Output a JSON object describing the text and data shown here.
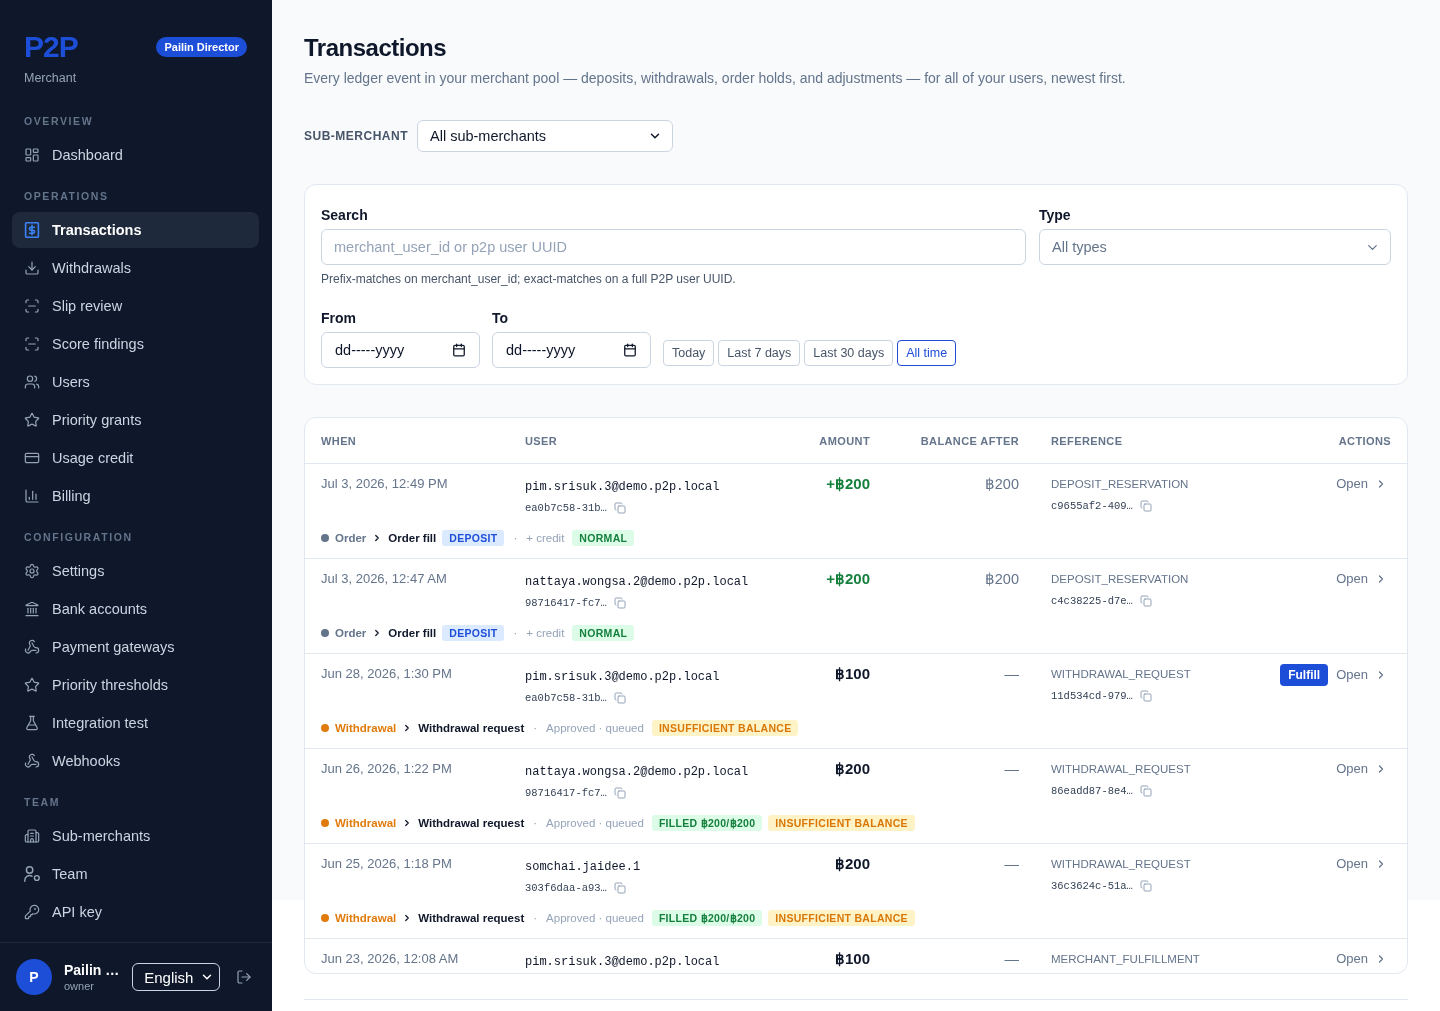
{
  "sidebar": {
    "logo": "P2P",
    "logo_subtitle": "Merchant",
    "role_badge": "Pailin Director",
    "sections": [
      {
        "label": "OVERVIEW",
        "items": [
          {
            "label": "Dashboard",
            "selected": false
          }
        ]
      },
      {
        "label": "OPERATIONS",
        "items": [
          {
            "label": "Transactions",
            "selected": true
          },
          {
            "label": "Withdrawals",
            "selected": false
          },
          {
            "label": "Slip review",
            "selected": false
          },
          {
            "label": "Score findings",
            "selected": false
          },
          {
            "label": "Users",
            "selected": false
          },
          {
            "label": "Priority grants",
            "selected": false
          },
          {
            "label": "Usage credit",
            "selected": false
          },
          {
            "label": "Billing",
            "selected": false
          }
        ]
      },
      {
        "label": "CONFIGURATION",
        "items": [
          {
            "label": "Settings",
            "selected": false
          },
          {
            "label": "Bank accounts",
            "selected": false
          },
          {
            "label": "Payment gateways",
            "selected": false
          },
          {
            "label": "Priority thresholds",
            "selected": false
          },
          {
            "label": "Integration test",
            "selected": false
          },
          {
            "label": "Webhooks",
            "selected": false
          }
        ]
      },
      {
        "label": "TEAM",
        "items": [
          {
            "label": "Sub-merchants",
            "selected": false
          },
          {
            "label": "Team",
            "selected": false
          },
          {
            "label": "API key",
            "selected": false
          }
        ]
      }
    ],
    "user": {
      "avatar_initial": "P",
      "name": "Pailin …",
      "role": "owner",
      "language": "English"
    }
  },
  "page": {
    "title": "Transactions",
    "subtitle": "Every ledger event in your merchant pool — deposits, withdrawals, order holds, and adjustments — for all of your users, newest first."
  },
  "sub_merchant_filter": {
    "label": "SUB-MERCHANT",
    "value": "All sub-merchants"
  },
  "filters": {
    "search": {
      "label": "Search",
      "placeholder": "merchant_user_id or p2p user UUID",
      "hint": "Prefix-matches on merchant_user_id; exact-matches on a full P2P user UUID."
    },
    "type": {
      "label": "Type",
      "value": "All types"
    },
    "from": {
      "label": "From",
      "placeholder": "dd-----yyyy"
    },
    "to": {
      "label": "To",
      "placeholder": "dd-----yyyy"
    },
    "quick_ranges": [
      {
        "label": "Today",
        "selected": false
      },
      {
        "label": "Last 7 days",
        "selected": false
      },
      {
        "label": "Last 30 days",
        "selected": false
      },
      {
        "label": "All time",
        "selected": true
      }
    ]
  },
  "table": {
    "columns": [
      "WHEN",
      "USER",
      "AMOUNT",
      "BALANCE AFTER",
      "REFERENCE",
      "ACTIONS"
    ],
    "rows": [
      {
        "kind": "credit",
        "when": "Jul 3, 2026, 12:49 PM",
        "user": "pim.srisuk.3@demo.p2p.local",
        "user_id": "ea0b7c58-31b…",
        "amount": "+฿200",
        "balance_after": "฿200",
        "reference": "DEPOSIT_RESERVATION",
        "reference_id": "c9655af2-409…",
        "open": "Open",
        "category": {
          "label": "Order",
          "color": "#64748b"
        },
        "subcategory": "Order fill",
        "type_badge": {
          "label": "DEPOSIT",
          "kind": "info"
        },
        "separator": "·",
        "note": "+ credit",
        "tags": [
          {
            "label": "NORMAL",
            "kind": "success"
          }
        ]
      },
      {
        "kind": "credit",
        "when": "Jul 3, 2026, 12:47 AM",
        "user": "nattaya.wongsa.2@demo.p2p.local",
        "user_id": "98716417-fc7…",
        "amount": "+฿200",
        "balance_after": "฿200",
        "reference": "DEPOSIT_RESERVATION",
        "reference_id": "c4c38225-d7e…",
        "open": "Open",
        "category": {
          "label": "Order",
          "color": "#64748b"
        },
        "subcategory": "Order fill",
        "type_badge": {
          "label": "DEPOSIT",
          "kind": "info"
        },
        "separator": "·",
        "note": "+ credit",
        "tags": [
          {
            "label": "NORMAL",
            "kind": "success"
          }
        ]
      },
      {
        "kind": "plain",
        "when": "Jun 28, 2026, 1:30 PM",
        "user": "pim.srisuk.3@demo.p2p.local",
        "user_id": "ea0b7c58-31b…",
        "amount": "฿100",
        "balance_after": "—",
        "reference": "WITHDRAWAL_REQUEST",
        "reference_id": "11d534cd-979…",
        "action_button": "Fulfill",
        "open": "Open",
        "category": {
          "label": "Withdrawal",
          "color": "#e07b0c"
        },
        "subcategory": "Withdrawal request",
        "separator": "·",
        "note": "Approved · queued",
        "tags": [
          {
            "label": "INSUFFICIENT BALANCE",
            "kind": "warning"
          }
        ]
      },
      {
        "kind": "plain",
        "when": "Jun 26, 2026, 1:22 PM",
        "user": "nattaya.wongsa.2@demo.p2p.local",
        "user_id": "98716417-fc7…",
        "amount": "฿200",
        "balance_after": "—",
        "reference": "WITHDRAWAL_REQUEST",
        "reference_id": "86eadd87-8e4…",
        "open": "Open",
        "category": {
          "label": "Withdrawal",
          "color": "#e07b0c"
        },
        "subcategory": "Withdrawal request",
        "separator": "·",
        "note": "Approved · queued",
        "tags": [
          {
            "label": "FILLED ฿200/฿200",
            "kind": "success"
          },
          {
            "label": "INSUFFICIENT BALANCE",
            "kind": "warning"
          }
        ]
      },
      {
        "kind": "plain",
        "when": "Jun 25, 2026, 1:18 PM",
        "user": "somchai.jaidee.1",
        "user_id": "303f6daa-a93…",
        "amount": "฿200",
        "balance_after": "—",
        "reference": "WITHDRAWAL_REQUEST",
        "reference_id": "36c3624c-51a…",
        "open": "Open",
        "category": {
          "label": "Withdrawal",
          "color": "#e07b0c"
        },
        "subcategory": "Withdrawal request",
        "separator": "·",
        "note": "Approved · queued",
        "tags": [
          {
            "label": "FILLED ฿200/฿200",
            "kind": "success"
          },
          {
            "label": "INSUFFICIENT BALANCE",
            "kind": "warning"
          }
        ]
      },
      {
        "kind": "plain",
        "when": "Jun 23, 2026, 12:08 AM",
        "user": "pim.srisuk.3@demo.p2p.local",
        "amount": "฿100",
        "balance_after": "—",
        "reference": "MERCHANT_FULFILLMENT",
        "open": "Open"
      }
    ]
  }
}
